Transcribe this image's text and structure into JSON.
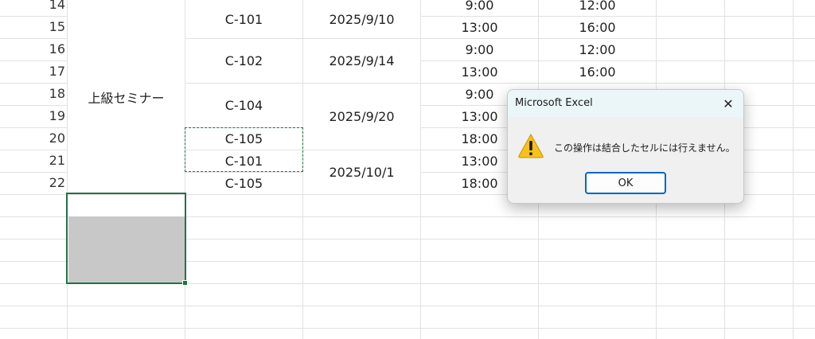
{
  "rows": [
    "14",
    "15",
    "16",
    "17",
    "18",
    "19",
    "20",
    "21",
    "22"
  ],
  "course": "上級セミナー",
  "rooms": {
    "r14": "C-101",
    "r16": "C-102",
    "r18": "C-104",
    "r20": "C-105",
    "r21": "C-101",
    "r22": "C-105"
  },
  "dates": {
    "d1": "2025/9/10",
    "d2": "2025/9/14",
    "d3": "2025/9/20",
    "d4": "2025/10/1"
  },
  "start_times": [
    "9:00",
    "13:00",
    "9:00",
    "13:00",
    "9:00",
    "13:00",
    "18:00",
    "13:00",
    "18:00"
  ],
  "end_times": [
    "12:00",
    "16:00",
    "12:00",
    "16:00"
  ],
  "dialog": {
    "title": "Microsoft Excel",
    "close_glyph": "✕",
    "message": "この操作は結合したセルには行えません。",
    "ok_label": "OK"
  }
}
